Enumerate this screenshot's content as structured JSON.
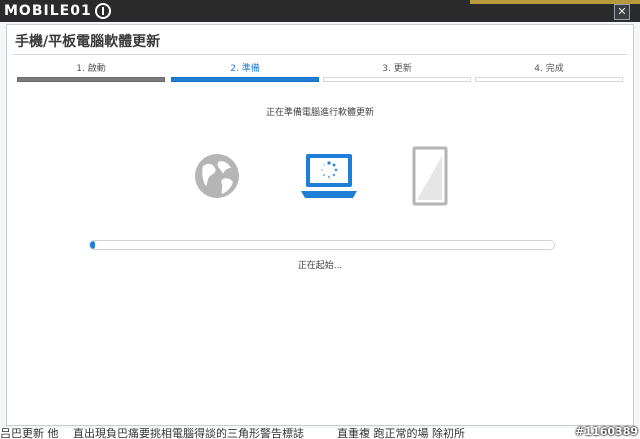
{
  "brand": {
    "logo_text": "MOBILE01"
  },
  "window": {
    "close_symbol": "✕"
  },
  "dialog": {
    "title": "手機/平板電腦軟體更新"
  },
  "steps": [
    {
      "label": "1. 啟動",
      "state": "done"
    },
    {
      "label": "2. 準備",
      "state": "active"
    },
    {
      "label": "3. 更新",
      "state": "pending"
    },
    {
      "label": "4. 完成",
      "state": "pending"
    }
  ],
  "status_message": "正在準備電腦進行軟體更新",
  "icons": {
    "globe": "globe-icon",
    "laptop": "laptop-loading-icon",
    "phone": "phone-icon"
  },
  "progress": {
    "value": 0.01,
    "text": "正在起始..."
  },
  "below_text": "吕巴更新 他 　直出現負巴痛要挑相電腦得談的三角形警告標誌　　　直重複 跑正常的場 除初所",
  "watermark": "#1160389",
  "colors": {
    "accent": "#1e7fd6",
    "done_step": "#7b7b7b",
    "icon_gray": "#b5b5b5"
  }
}
